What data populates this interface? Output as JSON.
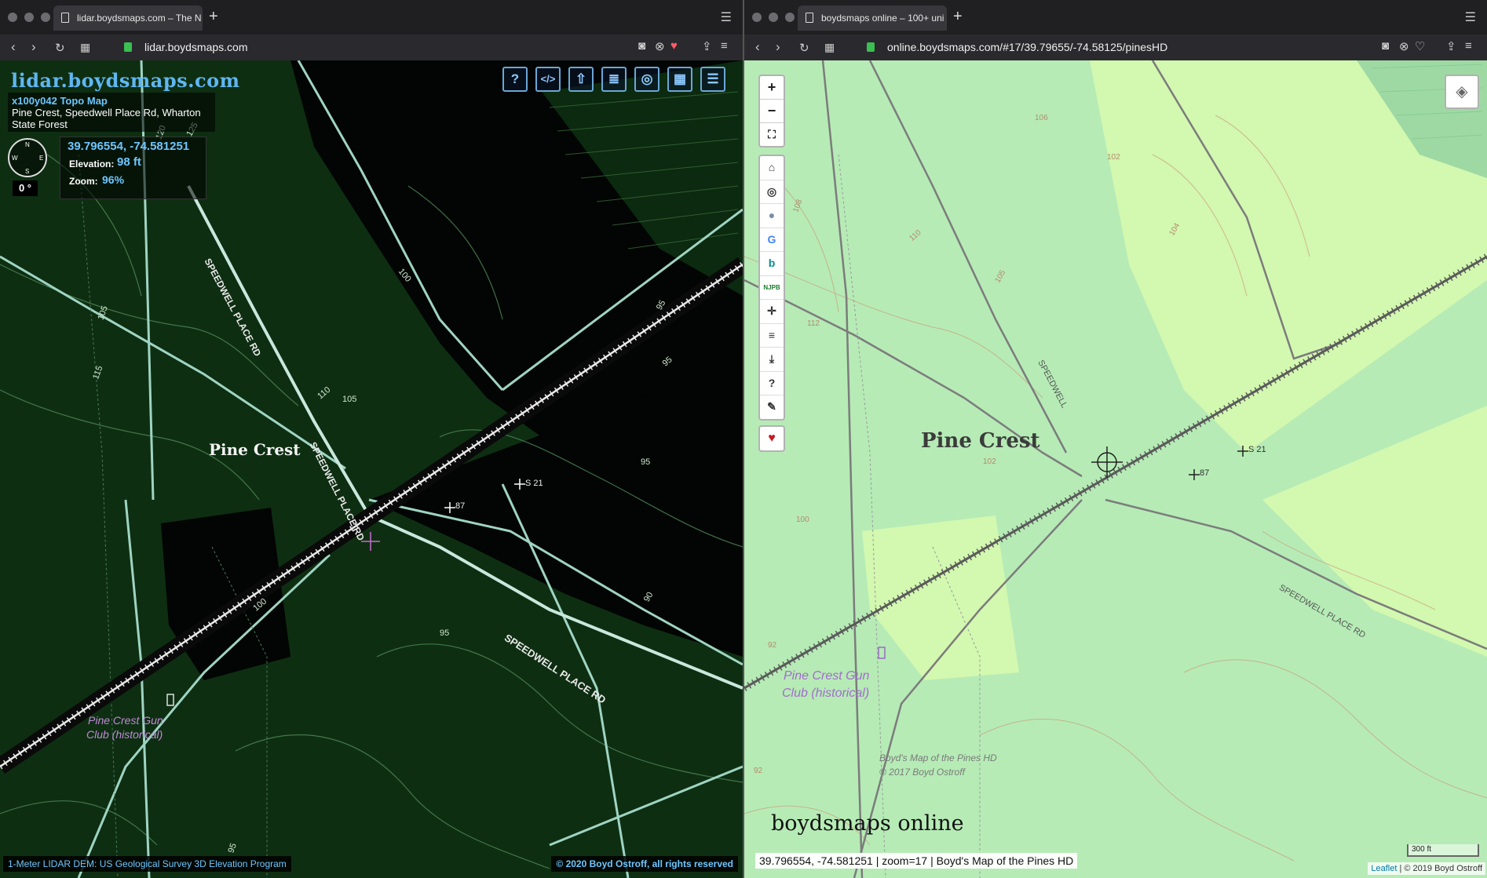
{
  "left": {
    "tab_title": "lidar.boydsmaps.com – The N",
    "url": "lidar.boydsmaps.com",
    "site_title": "lidar.boydsmaps.com",
    "map_subtitle": "x100y042 Topo Map",
    "location": "Pine Crest, Speedwell Place Rd, Wharton State Forest",
    "coordinates": "39.796554, -74.581251",
    "elevation_label": "Elevation:",
    "elevation_value": "98 ft",
    "zoom_label": "Zoom:",
    "zoom_value": "96%",
    "compass_heading": "0 °",
    "compass_letters": {
      "n": "N",
      "e": "E",
      "s": "S",
      "w": "W"
    },
    "tools": [
      "help-icon",
      "code-icon",
      "share-icon",
      "document-icon",
      "globe-icon",
      "grid-icon",
      "settings-sliders-icon"
    ],
    "tool_glyphs": {
      "help": "?",
      "code": "</>",
      "share": "⇧",
      "document": "≣",
      "globe": "◎",
      "grid": "▦",
      "sliders": "☰"
    },
    "footer_left": "1-Meter LIDAR DEM: US Geological Survey 3D Elevation Program",
    "footer_right": "© 2020 Boyd Ostroff, all rights reserved",
    "map_labels": {
      "place": "Pine Crest",
      "road": "SPEEDWELL PLACE RD",
      "road2": "SPEEDWELL PLACE RD",
      "road3": "SPEEDWELL PLACE RD",
      "gun_club_1": "Pine Crest Gun",
      "gun_club_2": "Club (historical)",
      "marker_87": "87",
      "marker_s21": "S 21",
      "contours": [
        "100",
        "105",
        "110",
        "115",
        "95",
        "95",
        "95",
        "90",
        "100",
        "105",
        "120",
        "125",
        "95",
        "95"
      ]
    },
    "accent_color": "#5fb7f2"
  },
  "right": {
    "tab_title": "boydsmaps online – 100+ uni",
    "url": "online.boydsmaps.com/#17/39.79655/-74.58125/pinesHD",
    "zoom_in": "+",
    "zoom_out": "−",
    "fullscreen": "⛶",
    "tools": [
      "home-icon",
      "target-icon",
      "globe-icon",
      "google-icon",
      "bing-icon",
      "njpb-icon",
      "crosshair-icon",
      "list-icon",
      "download-icon",
      "help-icon",
      "wrench-icon"
    ],
    "tool_glyphs": {
      "home": "⌂",
      "target": "◎",
      "globe": "●",
      "google": "G",
      "bing": "b",
      "njpb": "NJPB",
      "crosshair": "✛",
      "list": "≡",
      "download": "⤓",
      "help": "?",
      "wrench": "✎"
    },
    "heart": "♥",
    "layers_glyph": "◈",
    "brand": "boydsmaps online",
    "status": "39.796554, -74.581251 | zoom=17 | Boyd's Map of the Pines HD",
    "scale": "300 ft",
    "attribution_leaflet": "Leaflet",
    "attribution_rest": " | © 2019 Boyd Ostroff",
    "map_labels": {
      "place": "Pine Crest",
      "road": "SPEEDWELL PLACE RD",
      "road2": "SPEEDWELL",
      "gun_club_1": "Pine Crest Gun",
      "gun_club_2": "Club (historical)",
      "marker_87": "87",
      "marker_s21": "S 21",
      "credit_1": "Boyd's Map of the Pines HD",
      "credit_2": "© 2017 Boyd Ostroff",
      "contours": [
        "106",
        "102",
        "104",
        "108",
        "112",
        "110",
        "105",
        "100",
        "102",
        "92",
        "92"
      ]
    }
  }
}
